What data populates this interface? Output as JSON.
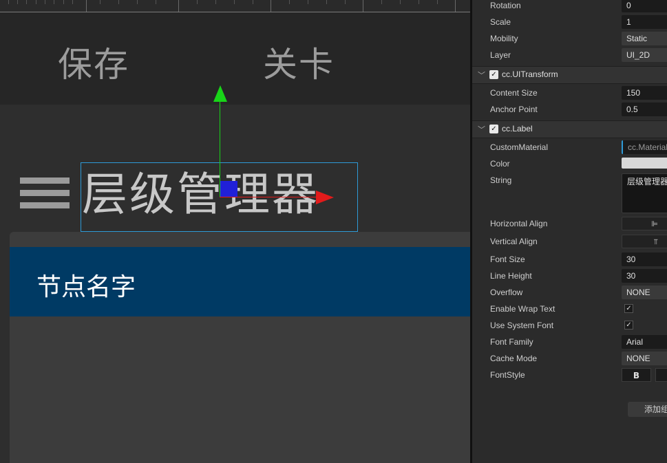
{
  "scene": {
    "top_buttons": [
      "保存",
      "关卡"
    ],
    "title_label": "层级管理器",
    "list_row_text": "节点名字",
    "menu_icon": "hamburger-menu-icon",
    "colors": {
      "selection_border": "#2e9bd8",
      "list_row_bg": "#003a64",
      "gizmo_y": "#18d418",
      "gizmo_x": "#e21b1b",
      "gizmo_center": "#2020d8"
    }
  },
  "inspector": {
    "node_props": [
      {
        "label": "Rotation",
        "value": "0"
      },
      {
        "label": "Scale",
        "value": "1"
      },
      {
        "label": "Mobility",
        "value": "Static"
      },
      {
        "label": "Layer",
        "value": "UI_2D"
      }
    ],
    "uitransform": {
      "title": "cc.UITransform",
      "props": [
        {
          "label": "Content Size",
          "value": "150"
        },
        {
          "label": "Anchor Point",
          "value": "0.5"
        }
      ]
    },
    "label": {
      "title": "cc.Label",
      "custom_material": {
        "label": "CustomMaterial",
        "value": "cc.Material"
      },
      "color": {
        "label": "Color",
        "value": "#d8d8d8"
      },
      "string": {
        "label": "String",
        "value": "层级管理器"
      },
      "horizontal_align": {
        "label": "Horizontal Align",
        "icon": "align-left-icon"
      },
      "vertical_align": {
        "label": "Vertical Align",
        "icon": "align-top-icon"
      },
      "font_size": {
        "label": "Font Size",
        "value": "30"
      },
      "line_height": {
        "label": "Line Height",
        "value": "30"
      },
      "overflow": {
        "label": "Overflow",
        "value": "NONE"
      },
      "enable_wrap_text": {
        "label": "Enable Wrap Text",
        "checked": true
      },
      "use_system_font": {
        "label": "Use System Font",
        "checked": true
      },
      "font_family": {
        "label": "Font Family",
        "value": "Arial"
      },
      "cache_mode": {
        "label": "Cache Mode",
        "value": "NONE"
      },
      "font_style": {
        "label": "FontStyle",
        "bold_label": "B"
      }
    },
    "add_component_label": "添加组"
  }
}
